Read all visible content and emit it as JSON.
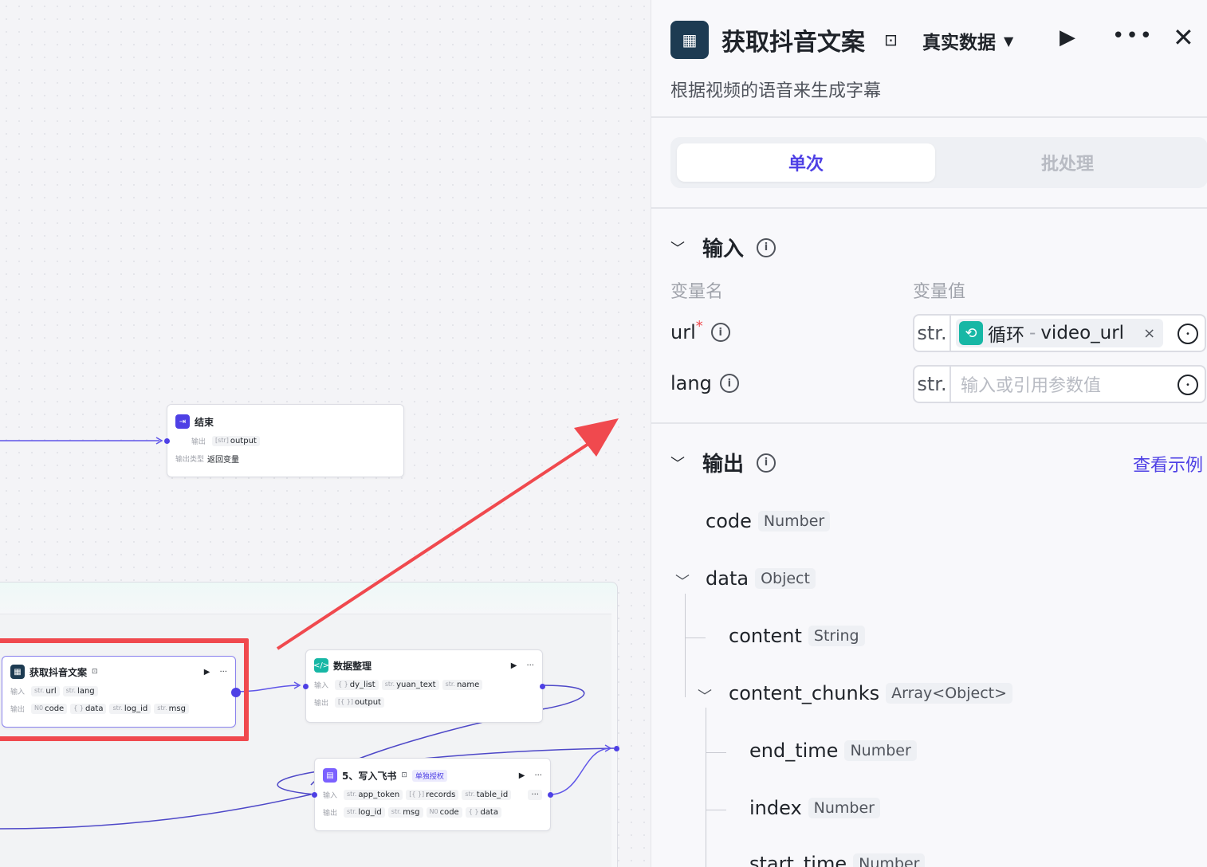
{
  "canvas": {
    "end_node": {
      "title": "结束",
      "output_label": "输出",
      "output_type": "[str]",
      "output_var": "output",
      "mode_label": "输出类型",
      "mode_value": "返回变量"
    },
    "main_node": {
      "title": "获取抖音文案",
      "in_label": "输入",
      "out_label": "输出",
      "inputs": [
        {
          "type": "str.",
          "name": "url"
        },
        {
          "type": "str.",
          "name": "lang"
        }
      ],
      "outputs": [
        {
          "type": "N0",
          "name": "code"
        },
        {
          "type": "{ }",
          "name": "data"
        },
        {
          "type": "str.",
          "name": "log_id"
        },
        {
          "type": "str.",
          "name": "msg"
        }
      ]
    },
    "data_node": {
      "title": "数据整理",
      "in_label": "输入",
      "out_label": "输出",
      "inputs": [
        {
          "type": "{ }",
          "name": "dy_list"
        },
        {
          "type": "str.",
          "name": "yuan_text"
        },
        {
          "type": "str.",
          "name": "name"
        }
      ],
      "outputs": [
        {
          "type": "[{ }]",
          "name": "output"
        }
      ]
    },
    "feishu_node": {
      "title": "5、写入飞书",
      "badge": "单独授权",
      "in_label": "输入",
      "out_label": "输出",
      "inputs": [
        {
          "type": "str.",
          "name": "app_token"
        },
        {
          "type": "[{ }]",
          "name": "records"
        },
        {
          "type": "str.",
          "name": "table_id"
        }
      ],
      "more": "···",
      "outputs": [
        {
          "type": "str.",
          "name": "log_id"
        },
        {
          "type": "str.",
          "name": "msg"
        },
        {
          "type": "N0",
          "name": "code"
        },
        {
          "type": "{ }",
          "name": "data"
        }
      ]
    }
  },
  "panel": {
    "title": "获取抖音文案",
    "mode": "真实数据",
    "description": "根据视频的语音来生成字幕",
    "tabs": [
      "单次",
      "批处理"
    ],
    "input_section": {
      "title": "输入",
      "col_name": "变量名",
      "col_value": "变量值",
      "rows": [
        {
          "name": "url",
          "required_mark": "*",
          "type": "str.",
          "ref_source": "循环",
          "ref_sep": "-",
          "ref_var": "video_url",
          "clear": "×"
        },
        {
          "name": "lang",
          "type": "str.",
          "placeholder": "输入或引用参数值"
        }
      ]
    },
    "output_section": {
      "title": "输出",
      "link": "查看示例",
      "items": [
        {
          "name": "code",
          "type": "Number"
        },
        {
          "name": "data",
          "type": "Object"
        },
        {
          "name": "content",
          "type": "String"
        },
        {
          "name": "content_chunks",
          "type": "Array<Object>"
        },
        {
          "name": "end_time",
          "type": "Number"
        },
        {
          "name": "index",
          "type": "Number"
        },
        {
          "name": "start_time",
          "type": "Number"
        }
      ]
    }
  },
  "colors": {
    "accent": "#4e40e5",
    "highlight_red": "#f0494e",
    "loop_teal": "#17b7a5"
  }
}
